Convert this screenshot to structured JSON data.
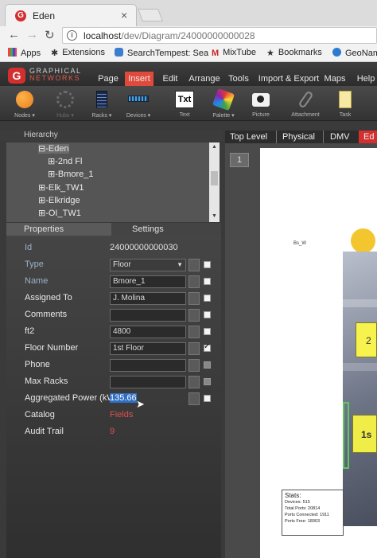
{
  "browser": {
    "tab_title": "Eden",
    "tab_close": "×",
    "url_host": "localhost",
    "url_path": "/dev/Diagram/24000000000028",
    "bookmarks": [
      "Apps",
      "Extensions",
      "SearchTempest: Sea",
      "MixTube",
      "Bookmarks",
      "GeoNam"
    ]
  },
  "app": {
    "logo_letter": "G",
    "logo_line1": "GRAPHICAL",
    "logo_line2": "NETWORKS",
    "menu": [
      "Page",
      "Insert",
      "Edit",
      "Arrange",
      "Tools",
      "Import & Export",
      "Maps",
      "Help"
    ],
    "active_menu": "Insert",
    "toolbar": [
      {
        "label": "Nodes ▾",
        "icon": "orange-circle-icon"
      },
      {
        "label": "Hubs ▾",
        "icon": "hub-icon",
        "disabled": true
      },
      {
        "label": "Racks ▾",
        "icon": "rack-icon"
      },
      {
        "label": "Devices ▾",
        "icon": "device-icon"
      },
      {
        "label": "Text",
        "icon": "text-icon",
        "glyph": "Txt"
      },
      {
        "label": "Palette ▾",
        "icon": "palette-icon"
      },
      {
        "label": "Picture",
        "icon": "camera-icon"
      },
      {
        "label": "Attachment",
        "icon": "paperclip-icon"
      },
      {
        "label": "Task",
        "icon": "task-icon"
      }
    ]
  },
  "hierarchy": {
    "title": "Hierarchy",
    "items": [
      {
        "label": "⊟-Eden",
        "selected": true
      },
      {
        "label": "⊞-2nd Fl"
      },
      {
        "label": "⊞-Bmore_1"
      },
      {
        "label": "⊞-Elk_TW1"
      },
      {
        "label": "⊞-Elkridge"
      },
      {
        "label": "⊞-OI_TW1"
      }
    ]
  },
  "panel_tabs": [
    "Properties",
    "Settings"
  ],
  "properties": [
    {
      "label": "Id",
      "value": "24000000000030",
      "kind": "text"
    },
    {
      "label": "Type",
      "value": "Floor",
      "kind": "select"
    },
    {
      "label": "Name",
      "value": "Bmore_1",
      "kind": "field"
    },
    {
      "label": "Assigned To",
      "value": "J. Molina",
      "kind": "field"
    },
    {
      "label": "Comments",
      "value": "",
      "kind": "field"
    },
    {
      "label": "ft2",
      "value": "4800",
      "kind": "field"
    },
    {
      "label": "Floor Number",
      "value": "1st Floor",
      "kind": "field",
      "checked": true
    },
    {
      "label": "Phone",
      "value": "",
      "kind": "field"
    },
    {
      "label": "Max Racks",
      "value": "",
      "kind": "field"
    },
    {
      "label": "Aggregated Power (kW)",
      "value": "135.66",
      "kind": "selected-text"
    },
    {
      "label": "Catalog",
      "value": "Fields",
      "kind": "link"
    },
    {
      "label": "Audit Trail",
      "value": "9",
      "kind": "link"
    }
  ],
  "canvas_tabs": [
    "Top Level",
    "Physical",
    "DMV",
    "Ed"
  ],
  "canvas": {
    "page_number": "1",
    "building_label": "Bs_W",
    "floor_tag_2": "2",
    "floor_tag_1": "1s",
    "stats_title": "Stats:",
    "stats_lines": [
      "Devices: 515",
      "Total Ports: 20814",
      "Ports Connected: 1911",
      "Ports Free: 18903"
    ]
  }
}
